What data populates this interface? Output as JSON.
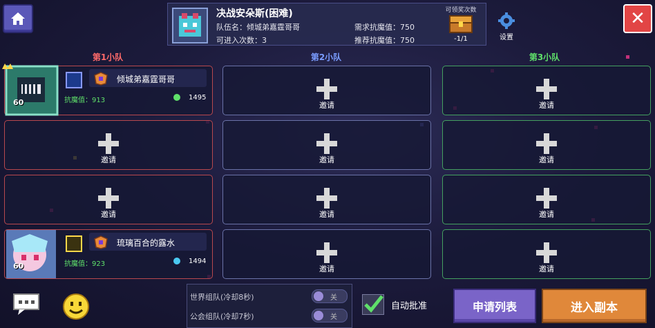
{
  "header": {
    "boss_title": "决战安朵斯(困难)",
    "team_name_label": "队伍名：倾城弟嘉霆哥哥",
    "entries_label": "可进入次数：3",
    "required_resist_label": "需求抗魔值：750",
    "recommended_resist_label": "推荐抗魔值：750",
    "reward_title": "可领奖次数",
    "reward_count": "-1/1",
    "settings_label": "设置"
  },
  "teams": [
    {
      "label": "第1小队",
      "color": "#ff6a6a"
    },
    {
      "label": "第2小队",
      "color": "#7a9cff"
    },
    {
      "label": "第3小队",
      "color": "#5fe06a"
    }
  ],
  "invite_label": "邀请",
  "members": [
    {
      "name": "倾城弟嘉霆哥哥",
      "level": "60",
      "resist": "抗魔值：913",
      "power": "1495"
    },
    {
      "name": "琉璃百合的露水",
      "level": "60",
      "resist": "抗魔值：923",
      "power": "1494"
    }
  ],
  "bottom": {
    "world_team": "世界组队(冷却8秒)",
    "guild_team": "公会组队(冷却7秒)",
    "toggle_off": "关",
    "auto_approve": "自动批准",
    "apply_list": "申请列表",
    "enter_dungeon": "进入副本"
  },
  "colors": {
    "team1_border": "#b8484e",
    "team2_border": "#6a72a8",
    "team3_border": "#44a060",
    "enter_button": "#e0883a",
    "apply_button": "#7a64c8"
  }
}
